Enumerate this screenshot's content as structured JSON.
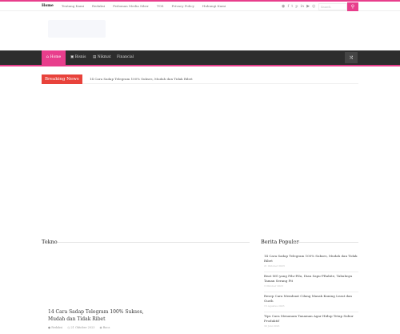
{
  "topnav": [
    "Home",
    "Tentang Kami",
    "Redaksi",
    "Pedoman Media Siber",
    "TOS",
    "Privacy Policy",
    "Hubungi Kami"
  ],
  "search": {
    "placeholder": "Search"
  },
  "social_icons": [
    "rss-icon",
    "facebook-icon",
    "twitter-icon",
    "pinterest-icon",
    "linkedin-icon",
    "youtube-icon",
    "instagram-icon"
  ],
  "mainnav": {
    "home": "Home",
    "items": [
      "Bisnis",
      "Nikmat",
      "Financial"
    ]
  },
  "breaking": {
    "label": "Breaking News",
    "headline": "14 Cara Sadap Telegram 100% Sukses, Mudah dan Tidak Ribet"
  },
  "sections": {
    "main": "Tekno",
    "sidebar": "Berita Populer"
  },
  "post": {
    "title": "14 Cara Sadap Telegram 100% Sukses, Mudah dan Tidak Ribet",
    "author": "Redaksi",
    "date": "21 Oktober 2023",
    "action": "Baca"
  },
  "popular": [
    {
      "title": "14 Cara Sadap Telegram 100% Sukses, Mudah dan Tidak Ribet",
      "date": "21 Oktober 2023"
    },
    {
      "title": "Beat MG yang Pilu-Pilu, Dian Sapu-PRabite, Tahuhnya Taman Serang Pit",
      "date": "3 Oktober 2023"
    },
    {
      "title": "Resep Cara Membuat Cilang Masak Kuning Lezat dan Gurih",
      "date": "15 Agustus 2023"
    },
    {
      "title": "Tips Cara Menanam Tanaman Agar Hidup Tetap Subur Produktif",
      "date": "30 Juni 2023"
    }
  ],
  "colors": {
    "accent": "#e83e8c",
    "nav_bg": "#2d2d2d",
    "breaking": "#e8423b"
  }
}
